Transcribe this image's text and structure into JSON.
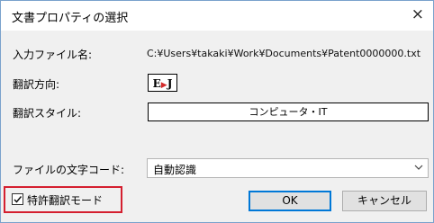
{
  "window": {
    "title": "文書プロパティの選択",
    "close_glyph": "×"
  },
  "fields": {
    "input_file_label": "入力ファイル名:",
    "input_file_value": "C:¥Users¥takaki¥Work¥Documents¥Patent0000000.txt",
    "direction_label": "翻訳方向:",
    "direction_from": "E",
    "direction_arrow": "▶",
    "direction_to": "J",
    "style_label": "翻訳スタイル:",
    "style_value": "コンピュータ・IT",
    "encoding_label": "ファイルの文字コード:",
    "encoding_value": "自動認識"
  },
  "patent_mode": {
    "label": "特許翻訳モード",
    "checked": true,
    "highlight_color": "#d41f2f"
  },
  "buttons": {
    "ok": "OK",
    "cancel": "キャンセル"
  },
  "colors": {
    "focus_border": "#0078d7",
    "arrow": "#d42a2a"
  },
  "icons": {
    "close": "close-icon",
    "dropdown": "chevron-down-icon",
    "check": "checkmark-icon"
  }
}
